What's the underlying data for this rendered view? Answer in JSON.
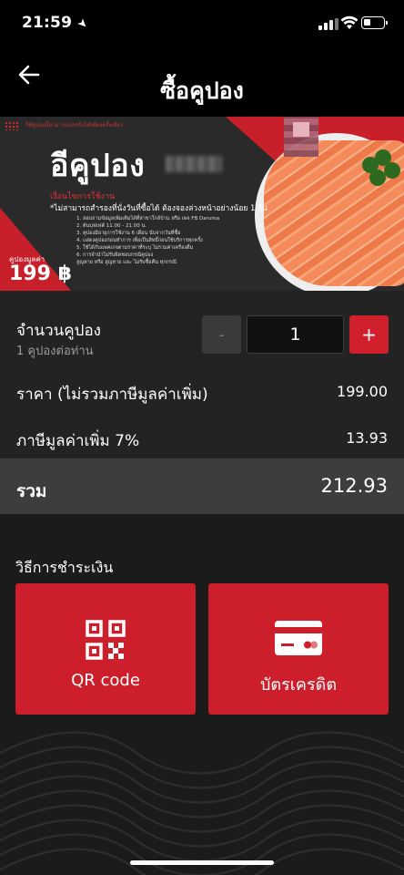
{
  "status_bar": {
    "time": "21:59",
    "location_glyph": "➤"
  },
  "header": {
    "title": "ซื้อคูปอง",
    "back_icon": "back-arrow-icon"
  },
  "banner": {
    "small_top_text": "ใช้คูปองนี้สามารถแลกรับได้เพียงครั้งเดียว",
    "heading": "อีคูปอง",
    "subheading": "เงื่อนไขการใช้งาน",
    "note": "*ไม่สามารถสำรองที่นั่งวันที่ซื้อได้ ต้องจองล่วงหน้าอย่างน้อย 1 วัน",
    "conditions": [
      "1. สอบถามข้อมูลเพิ่มเติมได้ที่สาขาใกล้บ้าน หรือ เพจ FB Daruma",
      "2. ต้นบุฟเฟต์ 11.00 - 21.00 น.",
      "3. คูปองมีอายุการใช้งาน 6 เดือน นับจากวันที่ซื้อ",
      "4. แสดงคูปองก่อนทำการ เพื่อเป็นสิทธิ์ก่อนใช้บริการทุกครั้ง",
      "5. ใช้ได้กับแพคเกจตามราคาที่ระบุ ไม่รวมค่าเครื่องดื่ม",
      "6. การจำนำไม่รับผิดชอบกรณีคูปอง",
      "สูญหาย หรือ สูญหาย และ ไม่รับซื้อคืน ทุกกรณี"
    ],
    "price_label": "คูปองมูลค่า",
    "price": "199 ฿"
  },
  "quantity": {
    "label": "จำนวนคูปอง",
    "sublabel": "1 คูปองต่อท่าน",
    "minus_label": "-",
    "value": "1",
    "plus_label": "+"
  },
  "price_rows": [
    {
      "label": "ราคา (ไม่รวมภาษีมูลค่าเพิ่ม)",
      "value": "199.00"
    },
    {
      "label": "ภาษีมูลค่าเพิ่ม 7%",
      "value": "13.93"
    }
  ],
  "total": {
    "label": "รวม",
    "value": "212.93"
  },
  "payment": {
    "title": "วิธีการชำระเงิน",
    "methods": [
      {
        "label": "QR code",
        "icon": "qr-code-icon"
      },
      {
        "label": "บัตรเครดิต",
        "icon": "credit-card-icon"
      }
    ]
  },
  "colors": {
    "accent": "#cd1f2b",
    "background": "#1b1b1b",
    "total_bar": "#3d3d3d",
    "header": "#000000"
  }
}
